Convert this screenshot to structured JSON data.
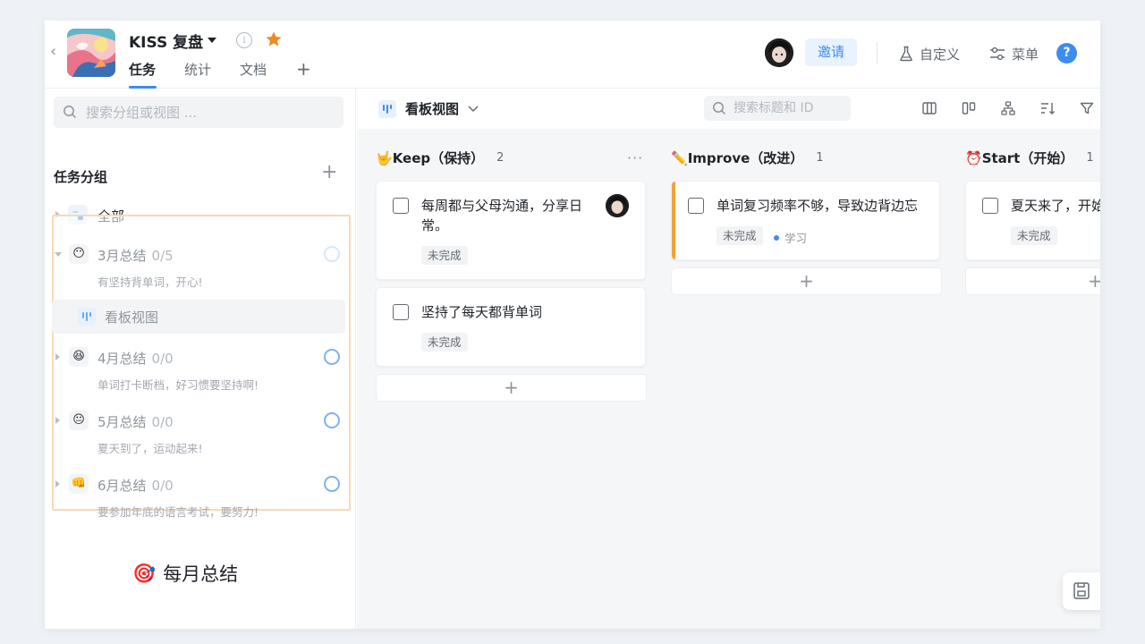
{
  "header": {
    "back_label": "‹",
    "project_title": "KISS 复盘",
    "tabs": [
      {
        "label": "任务"
      },
      {
        "label": "统计"
      },
      {
        "label": "文档"
      }
    ],
    "tab_add": "+",
    "invite_label": "邀请",
    "customize_label": "自定义",
    "menu_label": "菜单",
    "help_label": "?"
  },
  "sidebar": {
    "search_placeholder": "搜索分组或视图 ...",
    "section_title": "任务分组",
    "add_label": "+",
    "all_label": "全部",
    "groups": [
      {
        "emoji": "😶",
        "title": "3月总结",
        "count": "0/5",
        "desc": "有坚持背单词，开心!"
      },
      {
        "emoji": "😆",
        "title": "4月总结",
        "count": "0/0",
        "desc": "单词打卡断档，好习惯要坚持啊!"
      },
      {
        "emoji": "😐",
        "title": "5月总结",
        "count": "0/0",
        "desc": "夏天到了，运动起来!"
      },
      {
        "emoji": "👊",
        "title": "6月总结",
        "count": "0/0",
        "desc": "要参加年底的语言考试，要努力!"
      }
    ],
    "view_label": "看板视图",
    "month_label": "每月总结",
    "month_emoji": "🎯"
  },
  "toolbar": {
    "view_name": "看板视图",
    "search_placeholder": "搜索标题和 ID",
    "more": "···"
  },
  "columns": [
    {
      "emoji": "🤟",
      "title": "Keep（保持）",
      "count": "2",
      "more": "···",
      "cards": [
        {
          "title": "每周都与父母沟通，分享日常。",
          "status": "未完成"
        },
        {
          "title": "坚持了每天都背单词",
          "status": "未完成"
        }
      ]
    },
    {
      "emoji": "✏️",
      "title": "Improve（改进）",
      "count": "1",
      "more": "···",
      "cards": [
        {
          "title": "单词复习频率不够，导致边背边忘",
          "status": "未完成",
          "tag": "学习"
        }
      ]
    },
    {
      "emoji": "⏰",
      "title": "Start（开始）",
      "count": "1",
      "cards": [
        {
          "title": "夏天来了，开始",
          "status": "未完成"
        }
      ]
    }
  ],
  "add_card_label": "+",
  "colors": {
    "accent_blue": "#3c8cf0",
    "star_orange": "#f08a24",
    "improve_accent": "#f0a43a",
    "group_border": "#f9d9b4"
  }
}
